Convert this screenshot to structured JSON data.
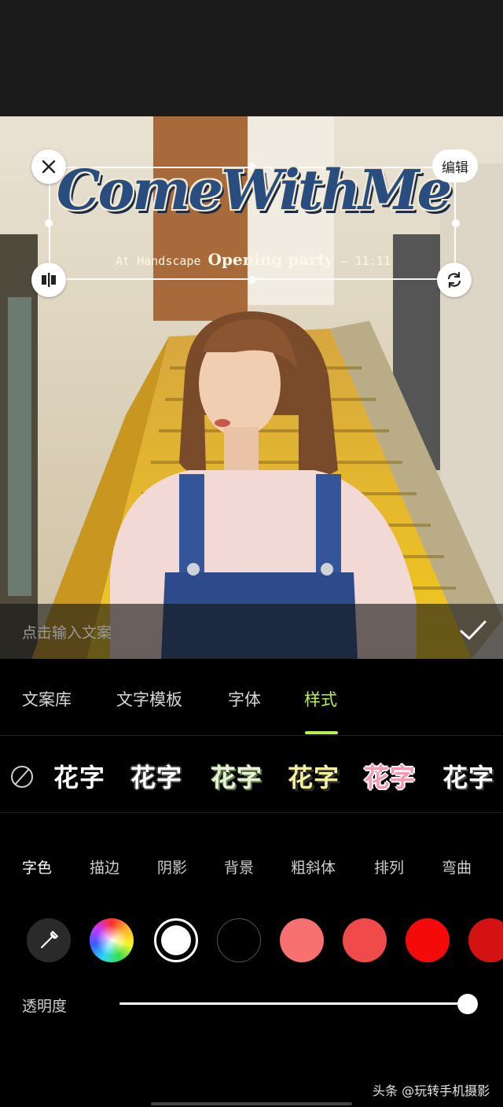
{
  "text_overlay": {
    "title": "ComeWithMe",
    "subtitle_prefix": "At Handscape",
    "subtitle_emphasis": "Opening party",
    "subtitle_suffix": "— 11:11",
    "title_color": "#2a4d80"
  },
  "box_controls": {
    "close_icon": "close-icon",
    "edit_label": "编辑",
    "mirror_icon": "mirror-icon",
    "rotate_icon": "rotate-icon"
  },
  "input": {
    "placeholder": "点击输入文案",
    "confirm_icon": "check-icon"
  },
  "tabs": [
    {
      "label": "文案库"
    },
    {
      "label": "文字模板"
    },
    {
      "label": "字体"
    },
    {
      "label": "样式",
      "active": true
    }
  ],
  "presets": {
    "none_icon": "no-style-icon",
    "items": [
      {
        "label": "花字",
        "fill": "#ffffff",
        "stroke": "#000000"
      },
      {
        "label": "花字",
        "fill": "#ffffff",
        "stroke": "#333333"
      },
      {
        "label": "花字",
        "fill": "#e8f0dc",
        "stroke": "#5c7a3a"
      },
      {
        "label": "花字",
        "fill": "#f4f0a0",
        "stroke": "#2d2d2d"
      },
      {
        "label": "花字",
        "fill": "#f59ab1",
        "stroke": "#ffffff"
      },
      {
        "label": "花字",
        "fill": "#ffffff",
        "stroke": "#444444"
      }
    ]
  },
  "subtabs": [
    {
      "label": "字色",
      "active": true
    },
    {
      "label": "描边"
    },
    {
      "label": "阴影"
    },
    {
      "label": "背景"
    },
    {
      "label": "粗斜体"
    },
    {
      "label": "排列"
    },
    {
      "label": "弯曲"
    }
  ],
  "colors": {
    "eyedropper_icon": "eyedropper-icon",
    "wheel_icon": "color-wheel-icon",
    "swatches": [
      "#ffffff",
      "#000000",
      "#f87171",
      "#f04a4a",
      "#f50a0a",
      "#d51212"
    ],
    "selected": "#ffffff"
  },
  "opacity": {
    "label": "透明度",
    "value": 1.0
  },
  "watermark": "头条 @玩转手机摄影",
  "accent_color": "#b7f34a"
}
